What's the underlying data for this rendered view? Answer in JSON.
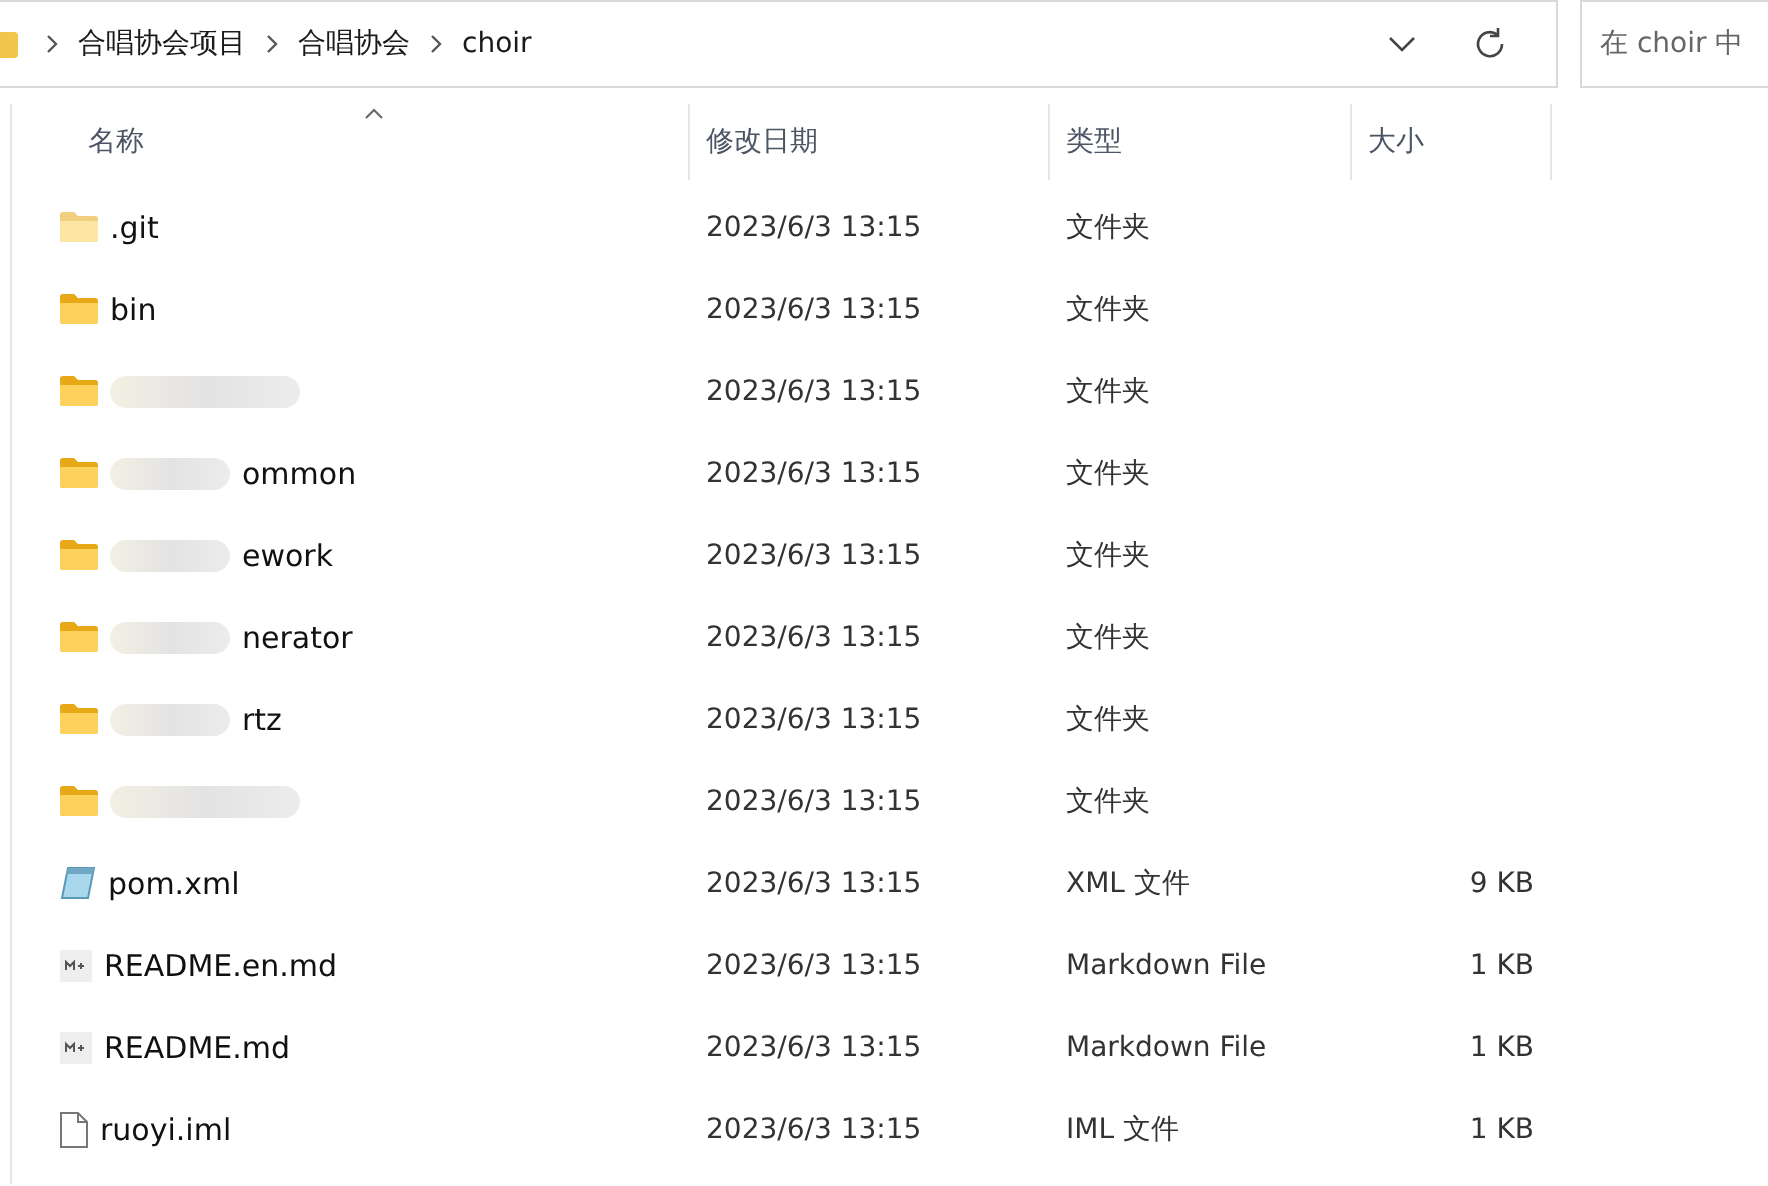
{
  "address_bar": {
    "path": [
      "合唱协会项目",
      "合唱协会",
      "choir"
    ]
  },
  "search": {
    "placeholder": "在 choir 中"
  },
  "columns": [
    {
      "label": "名称",
      "sorted": true
    },
    {
      "label": "修改日期",
      "sorted": false
    },
    {
      "label": "类型",
      "sorted": false
    },
    {
      "label": "大小",
      "sorted": false
    }
  ],
  "files": [
    {
      "kind": "folder",
      "hidden": true,
      "redacted": false,
      "name": ".git",
      "modified": "2023/6/3 13:15",
      "type": "文件夹"
    },
    {
      "kind": "folder",
      "hidden": false,
      "redacted": false,
      "name": "bin",
      "modified": "2023/6/3 13:15",
      "type": "文件夹"
    },
    {
      "kind": "folder",
      "hidden": false,
      "redacted": true,
      "modified": "2023/6/3 13:15",
      "type": "文件夹"
    },
    {
      "kind": "folder",
      "hidden": false,
      "redacted": true,
      "name": "ommon",
      "modified": "2023/6/3 13:15",
      "type": "文件夹"
    },
    {
      "kind": "folder",
      "hidden": false,
      "redacted": true,
      "name": "ework",
      "modified": "2023/6/3 13:15",
      "type": "文件夹"
    },
    {
      "kind": "folder",
      "hidden": false,
      "redacted": true,
      "name": "nerator",
      "modified": "2023/6/3 13:15",
      "type": "文件夹"
    },
    {
      "kind": "folder",
      "hidden": false,
      "redacted": true,
      "name": "rtz",
      "modified": "2023/6/3 13:15",
      "type": "文件夹"
    },
    {
      "kind": "folder",
      "hidden": false,
      "redacted": true,
      "modified": "2023/6/3 13:15",
      "type": "文件夹"
    },
    {
      "kind": "xml",
      "hidden": false,
      "redacted": false,
      "name": "pom.xml",
      "modified": "2023/6/3 13:15",
      "type": "XML 文件",
      "size": "9 KB"
    },
    {
      "kind": "markdown",
      "hidden": false,
      "redacted": false,
      "name": "README.en.md",
      "modified": "2023/6/3 13:15",
      "type": "Markdown File",
      "size": "1 KB"
    },
    {
      "kind": "markdown",
      "hidden": false,
      "redacted": false,
      "name": "README.md",
      "modified": "2023/6/3 13:15",
      "type": "Markdown File",
      "size": "1 KB"
    },
    {
      "kind": "file",
      "hidden": false,
      "redacted": false,
      "name": "ruoyi.iml",
      "modified": "2023/6/3 13:15",
      "type": "IML 文件",
      "size": "1 KB"
    }
  ]
}
